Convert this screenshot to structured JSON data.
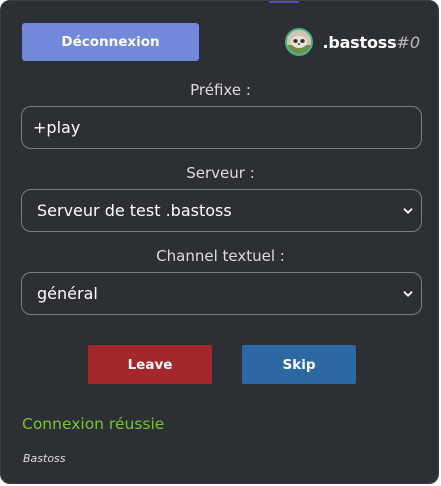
{
  "header": {
    "logout_label": "Déconnexion",
    "user": {
      "name": ".bastoss",
      "discriminator": "#0",
      "avatar_icon": "avatar-image"
    }
  },
  "form": {
    "prefix": {
      "label": "Préfixe :",
      "value": "+play"
    },
    "server": {
      "label": "Serveur :",
      "selected": "Serveur de test .bastoss"
    },
    "channel": {
      "label": "Channel textuel :",
      "selected": "général"
    }
  },
  "actions": {
    "leave_label": "Leave",
    "skip_label": "Skip"
  },
  "status_text": "Connexion réussie",
  "footer_text": "Bastoss",
  "colors": {
    "panel_bg": "#2c2f33",
    "logout_button": "#7289da",
    "leave_button": "#a4282b",
    "skip_button": "#2b68a4",
    "status_success": "#7cc339",
    "avatar_ring": "#43b581"
  }
}
